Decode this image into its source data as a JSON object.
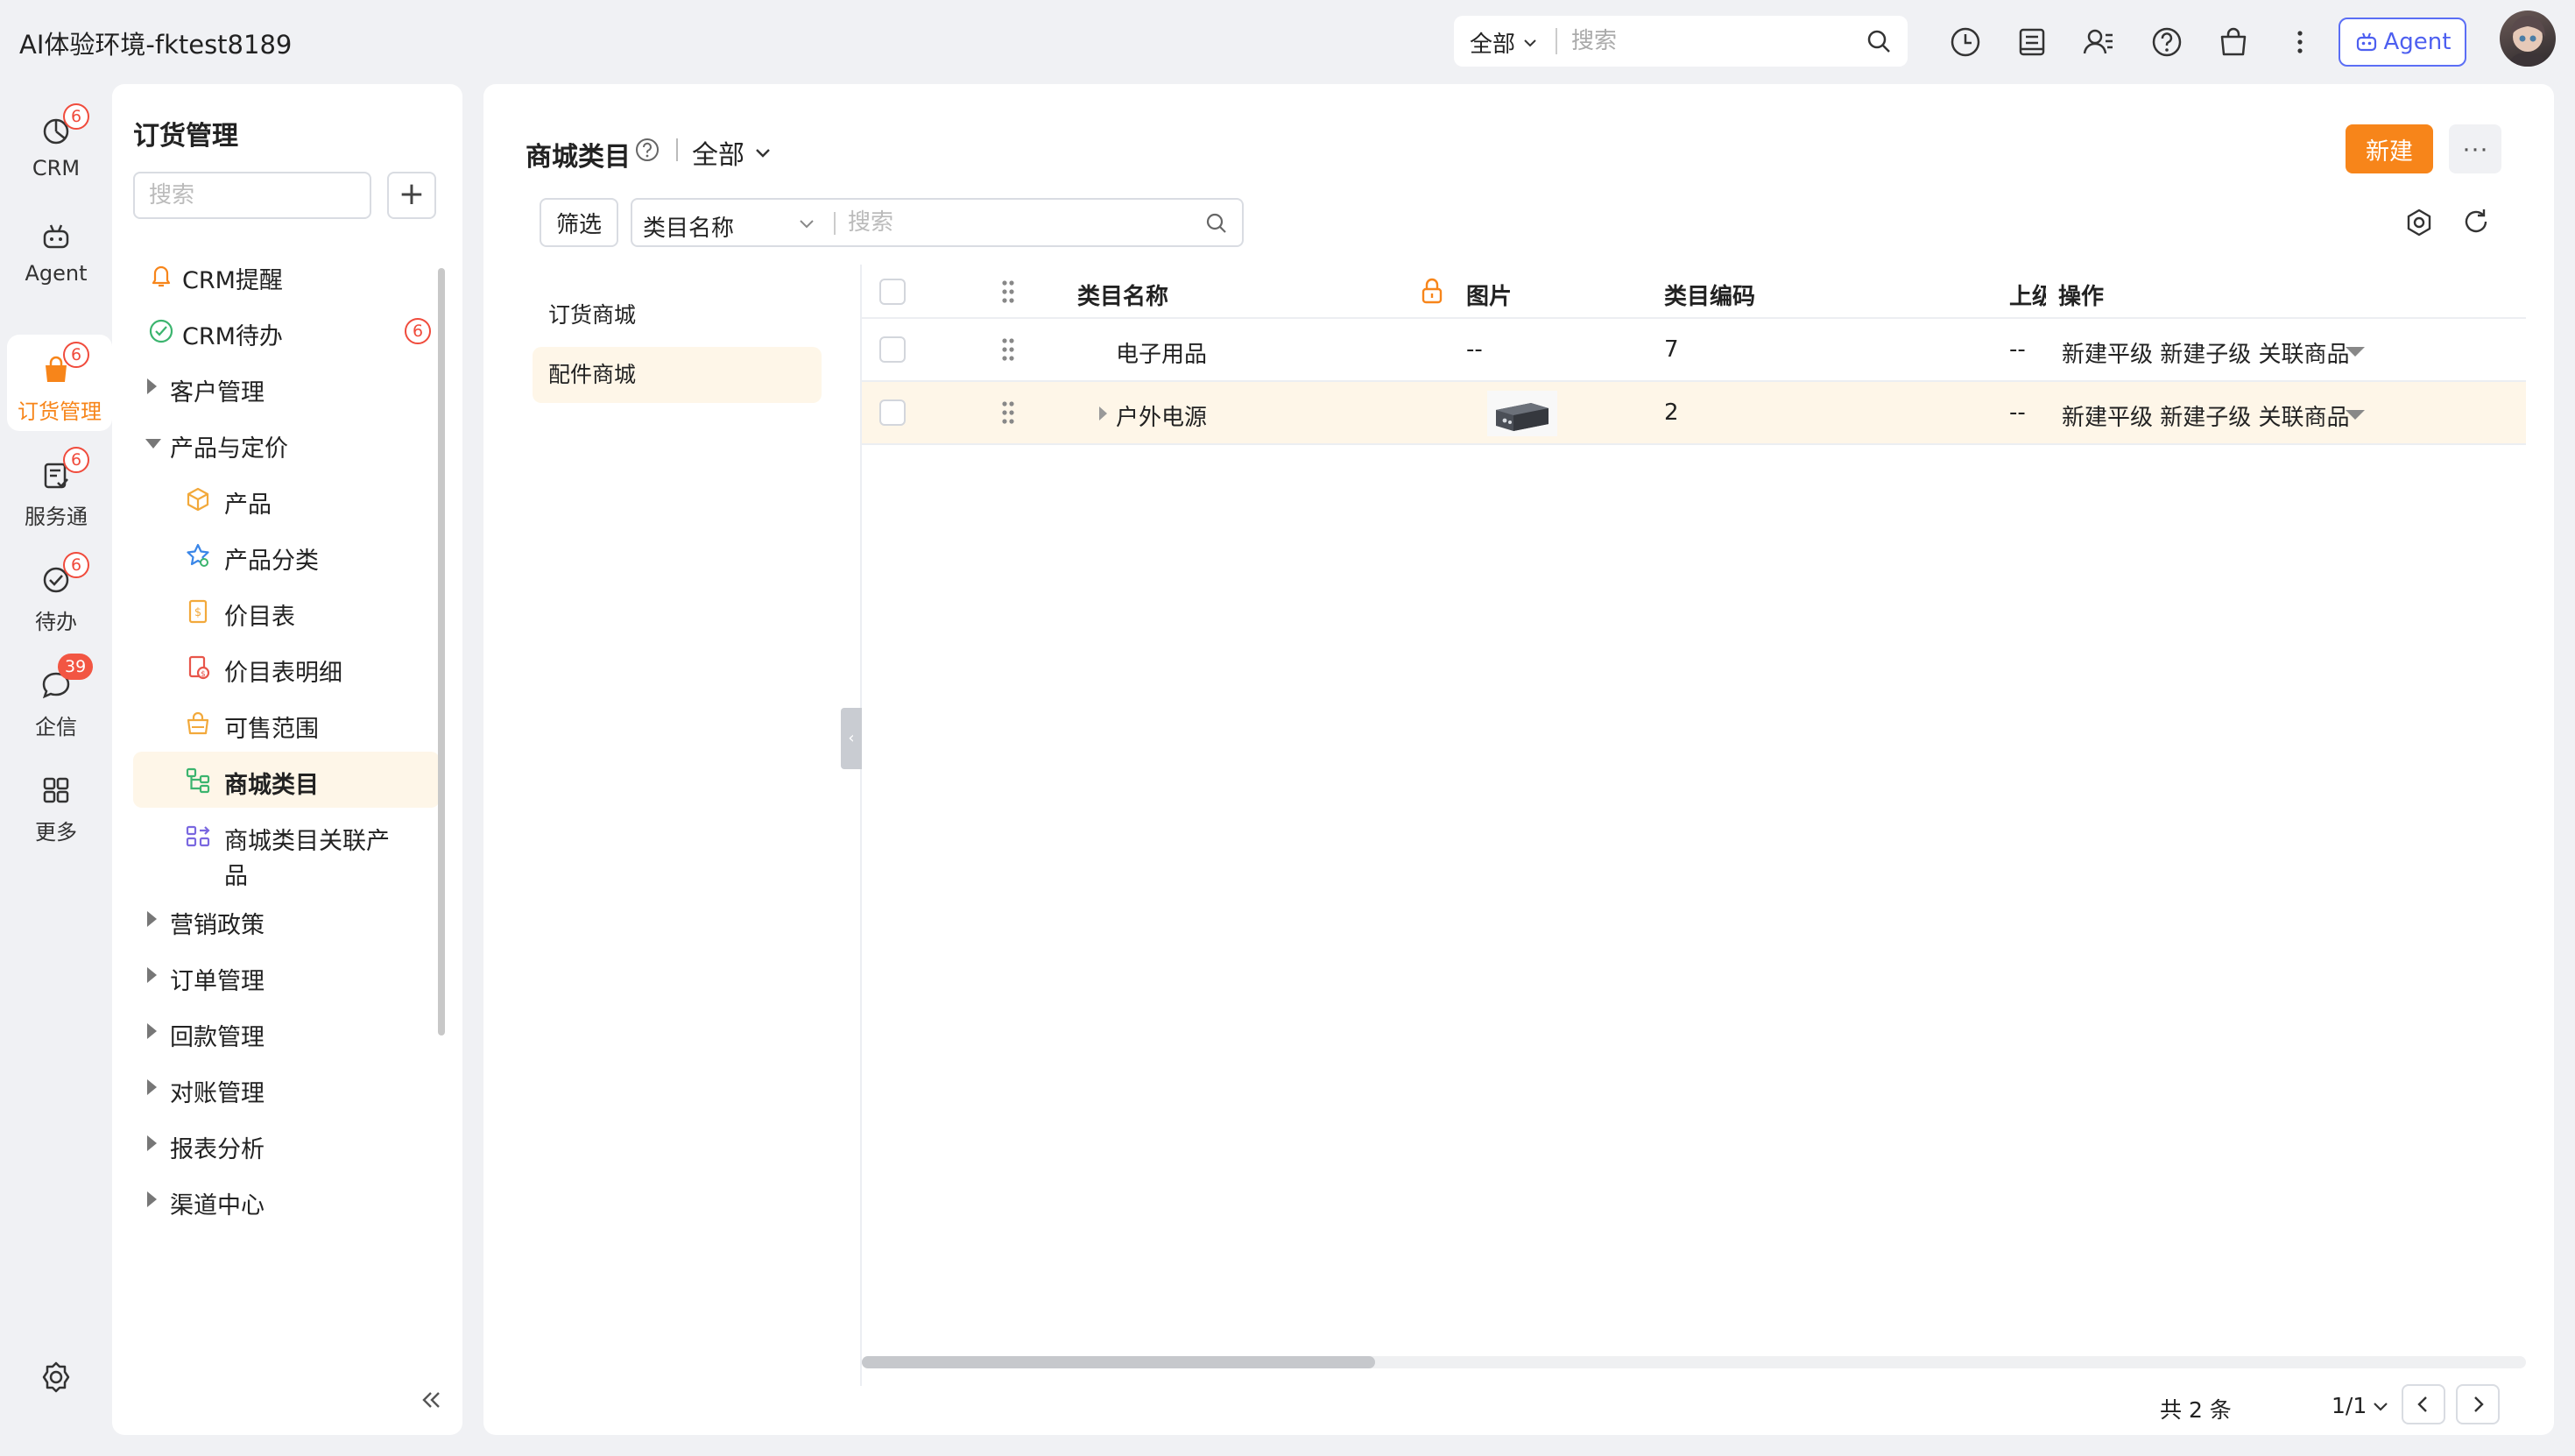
{
  "app": {
    "title": "AI体验环境-fktest8189"
  },
  "header": {
    "scope": "全部",
    "search_placeholder": "搜索",
    "agent_label": "Agent"
  },
  "rail": [
    {
      "label": "CRM",
      "badge": "6",
      "icon": "crm-icon"
    },
    {
      "label": "Agent",
      "badge": "",
      "icon": "agent-icon"
    },
    {
      "label": "订货管理",
      "badge": "6",
      "icon": "shopping-bag-icon",
      "active": true
    },
    {
      "label": "服务通",
      "badge": "6",
      "icon": "service-icon"
    },
    {
      "label": "待办",
      "badge": "6",
      "icon": "todo-icon"
    },
    {
      "label": "企信",
      "badge": "39",
      "icon": "chat-icon"
    },
    {
      "label": "更多",
      "badge": "",
      "icon": "grid-icon"
    }
  ],
  "sidebar": {
    "title": "订货管理",
    "search_placeholder": "搜索",
    "items": [
      {
        "label": "CRM提醒",
        "icon": "bell-icon"
      },
      {
        "label": "CRM待办",
        "icon": "check-circle-icon",
        "badge": "6"
      },
      {
        "label": "客户管理",
        "expandable": true
      },
      {
        "label": "产品与定价",
        "expanded": true
      },
      {
        "label": "产品",
        "icon": "cube-icon"
      },
      {
        "label": "产品分类",
        "icon": "star-category-icon"
      },
      {
        "label": "价目表",
        "icon": "price-list-icon"
      },
      {
        "label": "价目表明细",
        "icon": "price-detail-icon"
      },
      {
        "label": "可售范围",
        "icon": "sale-scope-icon"
      },
      {
        "label": "商城类目",
        "icon": "tree-icon",
        "active": true
      },
      {
        "label": "商城类目关联产",
        "label2": "品",
        "icon": "link-product-icon"
      },
      {
        "label": "营销政策",
        "expandable": true
      },
      {
        "label": "订单管理",
        "expandable": true
      },
      {
        "label": "回款管理",
        "expandable": true
      },
      {
        "label": "对账管理",
        "expandable": true
      },
      {
        "label": "报表分析",
        "expandable": true
      },
      {
        "label": "渠道中心",
        "expandable": true
      }
    ]
  },
  "main": {
    "title": "商城类目",
    "scope": "全部",
    "new_label": "新建",
    "more_label": "···",
    "filter_label": "筛选",
    "field_label": "类目名称",
    "search_placeholder": "搜索",
    "malls": [
      "订货商城",
      "配件商城"
    ],
    "columns": [
      "类目名称",
      "图片",
      "类目编码",
      "上级",
      "操作"
    ],
    "rows": [
      {
        "name": "电子用品",
        "image": "--",
        "code": "7",
        "parent": "--",
        "ops": "新建平级 新建子级 关联商品"
      },
      {
        "name": "户外电源",
        "image": "",
        "code": "2",
        "parent": "--",
        "ops": "新建平级 新建子级 关联商品"
      }
    ],
    "pager": {
      "total": "共 2 条",
      "page": "1/1"
    }
  },
  "colors": {
    "accent": "#f7851a",
    "badge": "#f04b3c",
    "agent": "#5b6ef5",
    "highlight": "#fef6e8"
  }
}
